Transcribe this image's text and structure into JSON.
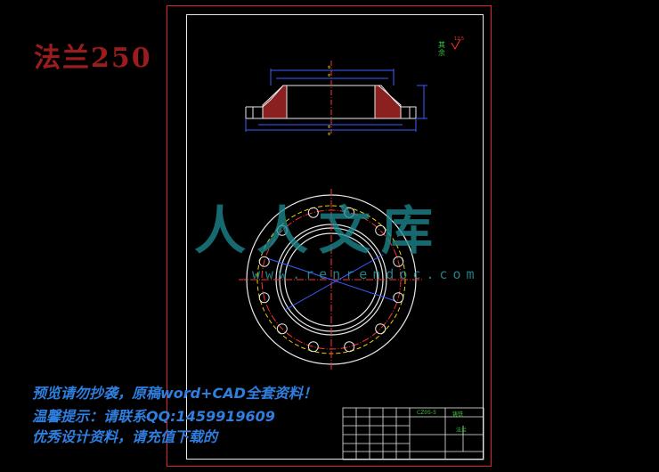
{
  "header": {
    "title": "法兰250"
  },
  "notices": [
    "预览请勿抄袭，原稿word+CAD全套资料！",
    "温馨提示：请联系QQ:1459919609",
    "优秀设计资料，请充值下载的"
  ],
  "watermark": {
    "text": "人人文库",
    "url": "www.renrendoc.com"
  },
  "drawing": {
    "finish_mark": "其余",
    "roughness": "12.5",
    "title_block": {
      "part_name": "法兰",
      "drawing_no": "CZ05-5",
      "material": "铸铁"
    }
  },
  "colors": {
    "frame_red": "#e0202a",
    "line_white": "#e8e8e8",
    "hole_blue": "#3b5bff",
    "center_red": "#ff3030",
    "pitch_yellow": "#f0d000",
    "dim_cyan": "#20b0d0",
    "text_green": "#33cc33",
    "notice_blue": "#2f7fe0",
    "title_darkred": "#9b1c1c"
  }
}
